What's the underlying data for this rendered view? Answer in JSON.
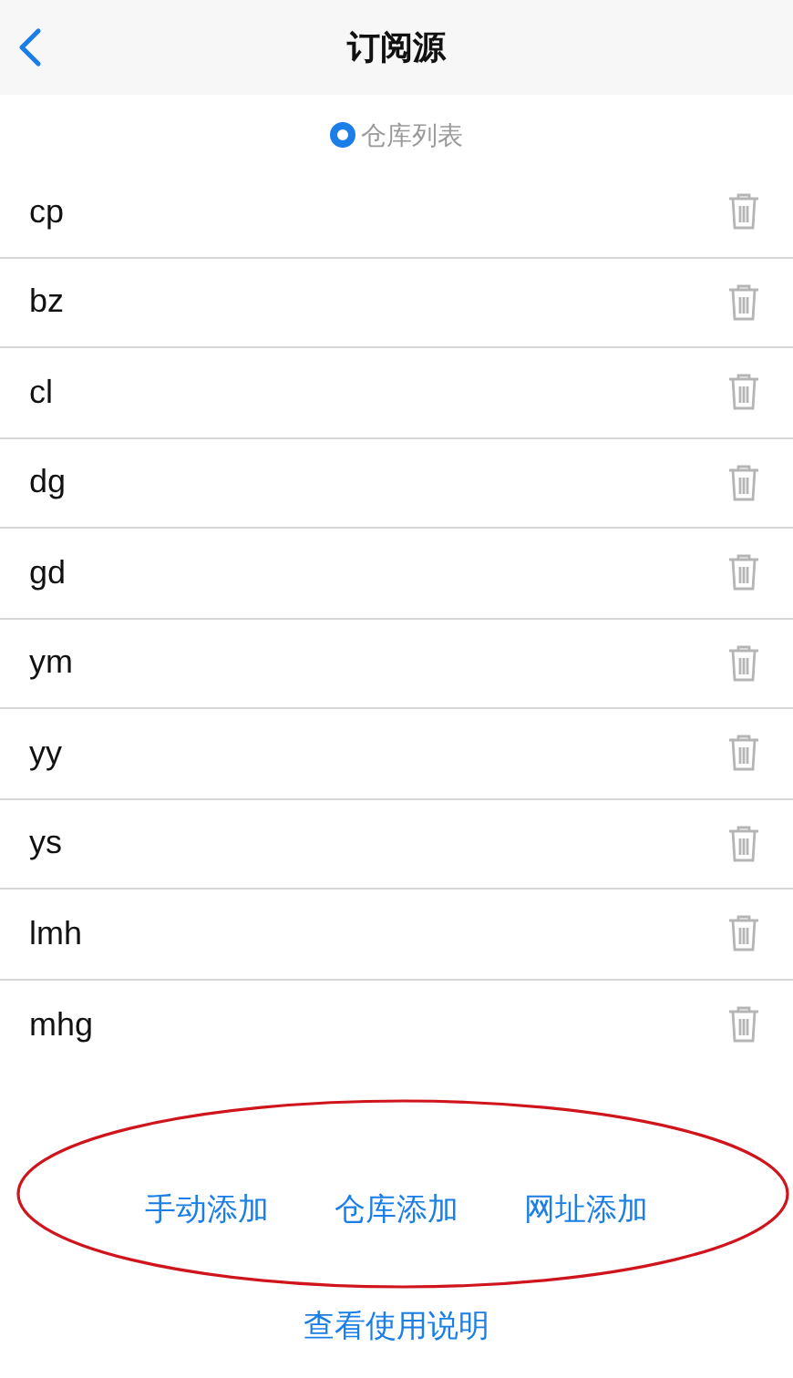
{
  "header": {
    "title": "订阅源"
  },
  "source_option": {
    "label": "仓库列表",
    "selected": true
  },
  "sources": [
    {
      "name": "cp"
    },
    {
      "name": "bz"
    },
    {
      "name": "cl"
    },
    {
      "name": "dg"
    },
    {
      "name": "gd"
    },
    {
      "name": "ym"
    },
    {
      "name": "yy"
    },
    {
      "name": "ys"
    },
    {
      "name": "lmh"
    },
    {
      "name": "mhg"
    }
  ],
  "add_actions": [
    "手动添加",
    "仓库添加",
    "网址添加"
  ],
  "help_link": "查看使用说明"
}
